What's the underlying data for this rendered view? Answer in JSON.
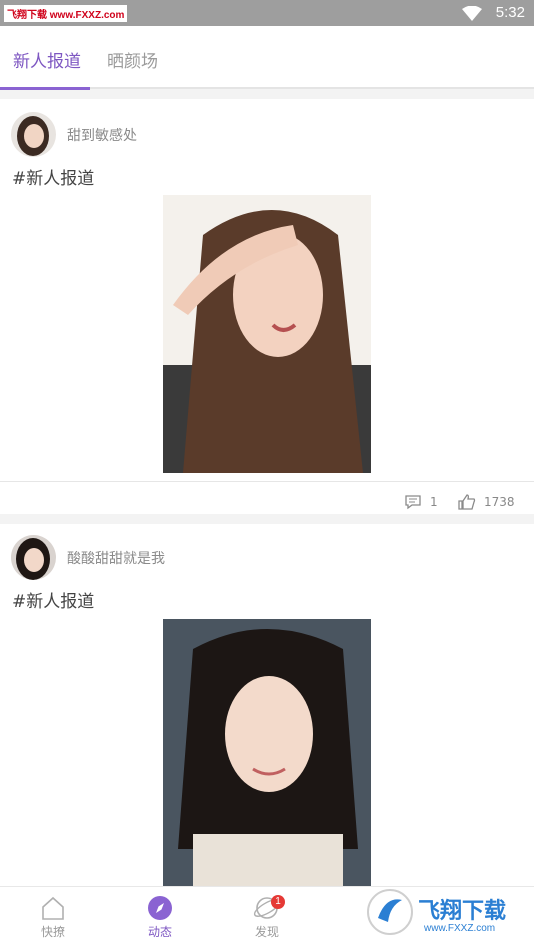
{
  "status_bar": {
    "watermark": "飞翔下载 www.FXXZ.com",
    "time": "5:32"
  },
  "tabs": [
    {
      "label": "新人报道",
      "active": true
    },
    {
      "label": "晒颜场",
      "active": false
    }
  ],
  "posts": [
    {
      "username": "甜到敏感处",
      "tag": "#新人报道",
      "comments": "1",
      "likes": "1738"
    },
    {
      "username": "酸酸甜甜就是我",
      "tag": "#新人报道"
    }
  ],
  "bottom_nav": [
    {
      "label": "快撩",
      "icon": "home-icon",
      "active": false
    },
    {
      "label": "动态",
      "icon": "compass-icon",
      "active": true
    },
    {
      "label": "发现",
      "icon": "planet-icon",
      "active": false,
      "badge": "1"
    }
  ],
  "corner_watermark": {
    "title": "飞翔下载",
    "url": "www.FXXZ.com"
  },
  "colors": {
    "accent": "#7e57c2",
    "status_bar": "#9e9e9e",
    "badge": "#e53935"
  }
}
